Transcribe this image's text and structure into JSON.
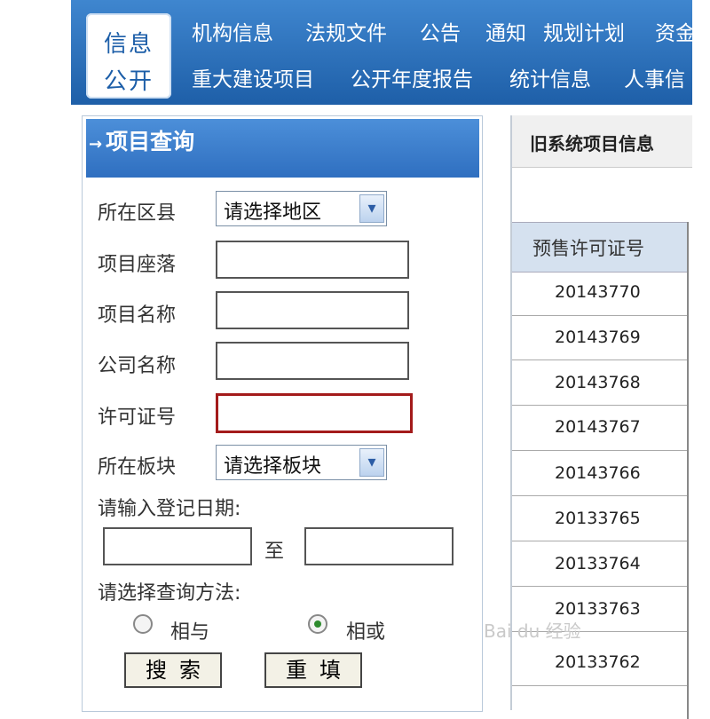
{
  "header": {
    "logo": [
      "信息",
      "公开"
    ],
    "nav_row1": [
      "机构信息",
      "法规文件",
      "公告",
      "通知",
      "规划计划",
      "资金"
    ],
    "nav_row2": [
      "重大建设项目",
      "公开年度报告",
      "统计信息",
      "人事信"
    ]
  },
  "query_panel": {
    "title": "项目查询",
    "district_label": "所在区县",
    "district_value": "请选择地区",
    "location_label": "项目座落",
    "name_label": "项目名称",
    "company_label": "公司名称",
    "license_label": "许可证号",
    "block_label": "所在板块",
    "block_value": "请选择板块",
    "date_prompt": "请输入登记日期:",
    "date_separator": "至",
    "method_prompt": "请选择查询方法:",
    "method_and": "相与",
    "method_or": "相或",
    "method_selected": "or",
    "search_button": "搜索",
    "reset_button": "重填"
  },
  "results": {
    "header": "旧系统项目信息",
    "column_header": "预售许可证号",
    "rows": [
      "20143770",
      "20143769",
      "20143768",
      "20143767",
      "20143766",
      "20133765",
      "20133764",
      "20133763",
      "20133762"
    ]
  },
  "watermark": "Bai du 经验"
}
